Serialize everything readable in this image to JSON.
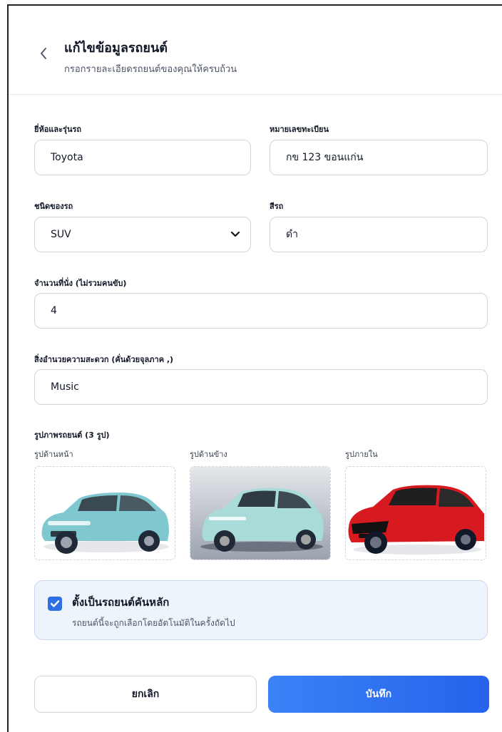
{
  "header": {
    "title": "แก้ไขข้อมูลรถยนต์",
    "subtitle": "กรอกรายละเอียดรถยนต์ของคุณให้ครบถ้วน"
  },
  "form": {
    "brand_label": "ยี่ห้อและรุ่นรถ",
    "brand_value": "Toyota",
    "plate_label": "หมายเลขทะเบียน",
    "plate_value": "กข 123 ขอนแก่น",
    "type_label": "ชนิดของรถ",
    "type_value": "SUV",
    "color_label": "สีรถ",
    "color_value": "ดำ",
    "seats_label": "จำนวนที่นั่ง (ไม่รวมคนขับ)",
    "seats_value": "4",
    "amenities_label": "สิ่งอำนวยความสะดวก (คั่นด้วยจุลภาค ,)",
    "amenities_value": "Music"
  },
  "photos": {
    "section_label": "รูปภาพรถยนต์ (3 รูป)",
    "front_label": "รูปด้านหน้า",
    "side_label": "รูปด้านข้าง",
    "interior_label": "รูปภายใน"
  },
  "main_car": {
    "checked": true,
    "title": "ตั้งเป็นรถยนต์คันหลัก",
    "subtitle": "รถยนต์นี้จะถูกเลือกโดยอัตโนมัติในครั้งถัดไป"
  },
  "actions": {
    "cancel_label": "ยกเลิก",
    "save_label": "บันทึก"
  },
  "colors": {
    "accent": "#2f6fe4",
    "car_teal": "#7fc8cf",
    "car_red": "#d71920"
  }
}
